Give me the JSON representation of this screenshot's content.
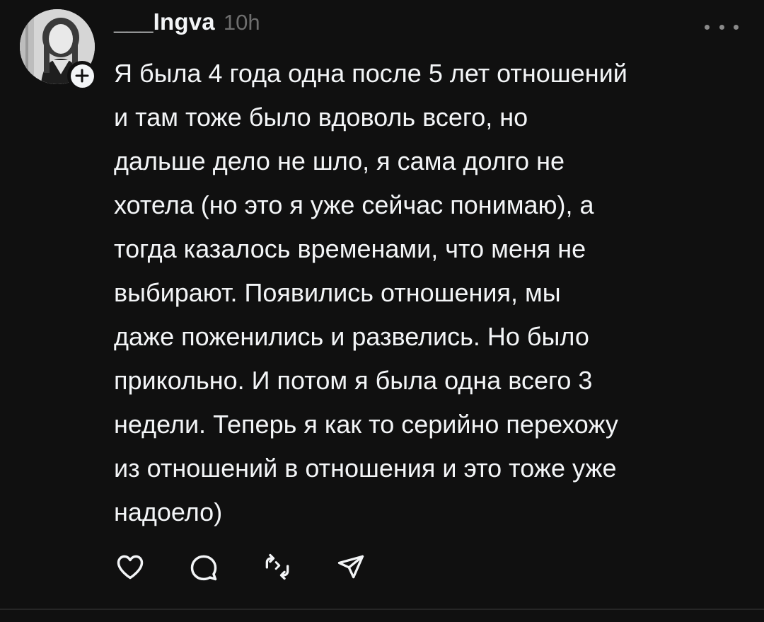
{
  "post": {
    "username": "___Ingva",
    "time": "10h",
    "text": "Я была 4 года одна после 5 лет отношений\nи там тоже было вдоволь всего, но\nдальше дело не шло, я сама долго не\nхотела (но это я уже сейчас понимаю), а\nтогда казалось временами, что меня не\nвыбирают. Появились отношения, мы\nдаже поженились и развелись. Но было\nприкольно. И потом я была одна всего 3\nнедели. Теперь я как то серийно перехожу\nиз отношений в отношения и это тоже уже\nнадоело)"
  },
  "icons": {
    "avatar": "avatar-photo",
    "follow": "plus-icon",
    "more": "more-horizontal-icon",
    "like": "heart-icon",
    "reply": "comment-icon",
    "repost": "repost-icon",
    "share": "send-icon"
  },
  "colors": {
    "background": "#101010",
    "text": "#f3f5f7",
    "muted": "#6e6e6e",
    "divider": "#262626"
  }
}
